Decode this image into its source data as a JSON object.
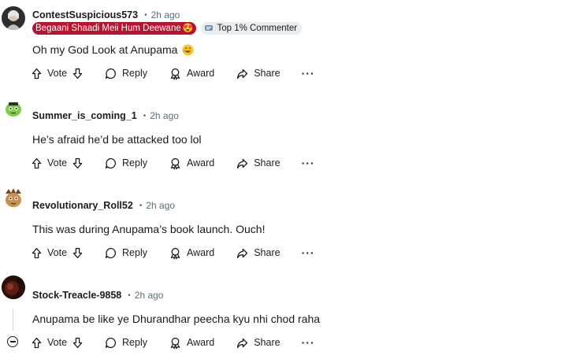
{
  "comments": [
    {
      "username": "ContestSuspicious573",
      "time": "2h ago",
      "flair": "Begaani Shaadi Meii Hum Deewane",
      "flair_emoji": "😍",
      "badge": "Top 1% Commenter",
      "text": "Oh my God Look at Anupama",
      "text_emoji": "laughing-emoji",
      "avatar_color": "#3a3a3a"
    },
    {
      "username": "Summer_is_coming_1",
      "time": "2h ago",
      "text": "He’s afraid he’d be attacked too lol",
      "avatar_color": "#7ecb4a"
    },
    {
      "username": "Revolutionary_Roll52",
      "time": "2h ago",
      "text": "This was during Anupama’s book launch. Ouch!",
      "avatar_color": "#a8723c"
    },
    {
      "username": "Stock-Treacle-9858",
      "time": "2h ago",
      "text": "Anupama be like ye Dhurandhar peecha kyu nhi chod raha",
      "avatar_color": "#5a1e14"
    }
  ],
  "actions": {
    "vote": "Vote",
    "reply": "Reply",
    "award": "Award",
    "share": "Share",
    "more": "···"
  },
  "colors": {
    "flair_bg": "#b7152f",
    "badge_bg": "#eaedef",
    "meta_text": "#576f76"
  },
  "icons": [
    "upvote-icon",
    "downvote-icon",
    "reply-icon",
    "award-icon",
    "share-icon",
    "more-icon",
    "collapse-icon"
  ]
}
